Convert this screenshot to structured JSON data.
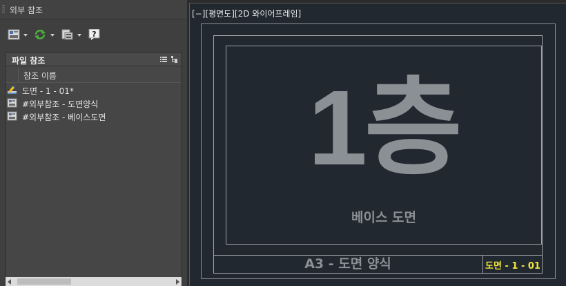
{
  "palette": {
    "title": "외부 참조",
    "toolbar": {
      "attach_icon": "attach-dwg-icon",
      "refresh_icon": "refresh-icon",
      "change_path_icon": "change-path-icon",
      "help_icon": "help-icon"
    },
    "file_references": {
      "header": "파일 참조",
      "list_view_icon": "list-view-icon",
      "tree_view_icon": "tree-view-icon",
      "column_header": "참조 이름",
      "items": [
        {
          "name": "도면 - 1 - 01*",
          "icon": "drawing-icon"
        },
        {
          "name": "#외부참조 - 도면양식",
          "icon": "dwg-file-icon"
        },
        {
          "name": "#외부참조 - 베이스도면",
          "icon": "dwg-file-icon"
        }
      ]
    }
  },
  "viewport": {
    "controls": "[−][평면도][2D 와이어프레임]",
    "floor_label": "1층",
    "base_plan_label": "베이스 도면",
    "title_block_text": "A3 - 도면 양식",
    "sheet_number": "도면 - 1 - 01",
    "colors": {
      "background": "#212830",
      "text_gray": "#8b9095",
      "sheet_number": "#f2e53a"
    }
  }
}
